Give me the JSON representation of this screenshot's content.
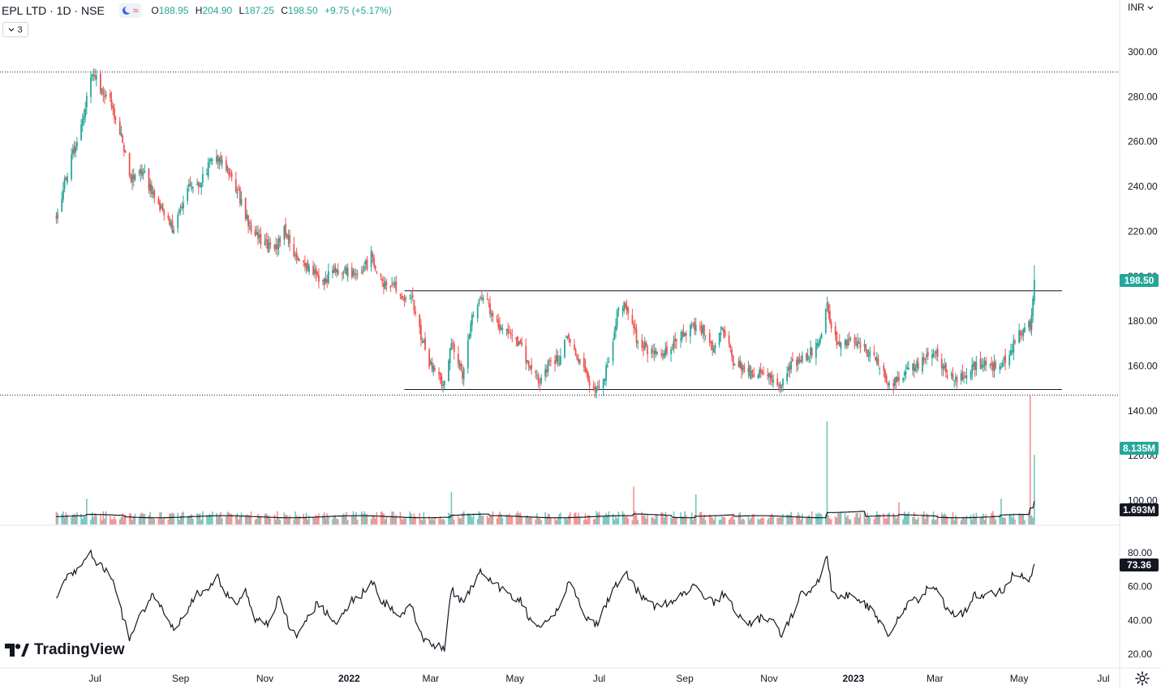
{
  "header": {
    "symbol": "EPL LTD · 1D · NSE",
    "open_key": "O",
    "open": "188.95",
    "high_key": "H",
    "high": "204.90",
    "low_key": "L",
    "low": "187.25",
    "close_key": "C",
    "close": "198.50",
    "change": "+9.75 (+5.17%)",
    "collapse_count": "3",
    "currency": "INR"
  },
  "branding": {
    "logo_text": "TradingView"
  },
  "icons": {
    "moon": "moon-icon",
    "wave": "wave-icon",
    "chevron": "chevron-down-icon",
    "settings": "gear-icon"
  },
  "colors": {
    "up": "#26a69a",
    "down": "#ef5350",
    "line": "#131722",
    "tag": "#26a69a",
    "tag_dark": "#131722"
  },
  "price_tag": "198.50",
  "volume_tag": "8.135M",
  "volume_ma_tag": "1.693M",
  "rsi_tag": "73.36",
  "chart_data": {
    "type": "candlestick",
    "x_labels": [
      "Jul",
      "Sep",
      "Nov",
      "2022",
      "Mar",
      "May",
      "Jul",
      "Sep",
      "Nov",
      "2023",
      "Mar",
      "May",
      "Jul"
    ],
    "price_axis": {
      "ticks": [
        "300.00",
        "280.00",
        "260.00",
        "240.00",
        "220.00",
        "200.00",
        "180.00",
        "160.00",
        "140.00",
        "120.00",
        "100.00"
      ],
      "range": [
        95,
        308
      ]
    },
    "rsi_axis": {
      "ticks": [
        "80.00",
        "60.00",
        "40.00",
        "20.00"
      ],
      "range": [
        15,
        85
      ]
    },
    "horizontal_lines": [
      {
        "value": 291,
        "style": "dotted"
      },
      {
        "value": 147,
        "style": "dotted"
      }
    ],
    "trend_lines": [
      {
        "from": "2022-02-10",
        "to": "2023-06-01",
        "value": 193.5
      },
      {
        "from": "2022-02-10",
        "to": "2023-06-01",
        "value": 149.5
      }
    ],
    "price_path": [
      [
        "2021-06-03",
        228
      ],
      [
        "2021-06-14",
        252
      ],
      [
        "2021-06-21",
        268
      ],
      [
        "2021-06-30",
        292
      ],
      [
        "2021-07-05",
        283
      ],
      [
        "2021-07-12",
        278
      ],
      [
        "2021-07-20",
        262
      ],
      [
        "2021-07-27",
        244
      ],
      [
        "2021-08-05",
        246
      ],
      [
        "2021-08-16",
        232
      ],
      [
        "2021-08-26",
        221
      ],
      [
        "2021-09-06",
        239
      ],
      [
        "2021-09-16",
        242
      ],
      [
        "2021-09-24",
        253
      ],
      [
        "2021-10-01",
        252
      ],
      [
        "2021-10-11",
        240
      ],
      [
        "2021-10-18",
        226
      ],
      [
        "2021-10-25",
        219
      ],
      [
        "2021-11-08",
        210
      ],
      [
        "2021-11-15",
        222
      ],
      [
        "2021-11-22",
        209
      ],
      [
        "2021-12-01",
        204
      ],
      [
        "2021-12-13",
        197
      ],
      [
        "2021-12-20",
        203
      ],
      [
        "2022-01-03",
        201
      ],
      [
        "2022-01-10",
        201
      ],
      [
        "2022-01-17",
        209
      ],
      [
        "2022-01-24",
        198
      ],
      [
        "2022-02-02",
        196
      ],
      [
        "2022-02-08",
        188
      ],
      [
        "2022-02-15",
        191
      ],
      [
        "2022-02-22",
        174
      ],
      [
        "2022-03-01",
        160
      ],
      [
        "2022-03-08",
        154
      ],
      [
        "2022-03-11",
        151
      ],
      [
        "2022-03-16",
        170
      ],
      [
        "2022-03-21",
        163
      ],
      [
        "2022-03-24",
        156
      ],
      [
        "2022-03-30",
        180
      ],
      [
        "2022-04-06",
        193
      ],
      [
        "2022-04-12",
        186
      ],
      [
        "2022-04-20",
        178
      ],
      [
        "2022-04-28",
        173
      ],
      [
        "2022-05-05",
        169
      ],
      [
        "2022-05-12",
        158
      ],
      [
        "2022-05-19",
        153
      ],
      [
        "2022-05-26",
        162
      ],
      [
        "2022-06-02",
        163
      ],
      [
        "2022-06-09",
        174
      ],
      [
        "2022-06-16",
        162
      ],
      [
        "2022-06-24",
        153
      ],
      [
        "2022-06-30",
        150
      ],
      [
        "2022-07-05",
        155
      ],
      [
        "2022-07-11",
        172
      ],
      [
        "2022-07-15",
        186
      ],
      [
        "2022-07-21",
        186
      ],
      [
        "2022-07-28",
        172
      ],
      [
        "2022-08-04",
        168
      ],
      [
        "2022-08-11",
        165
      ],
      [
        "2022-08-18",
        167
      ],
      [
        "2022-08-25",
        170
      ],
      [
        "2022-09-01",
        174
      ],
      [
        "2022-09-08",
        178
      ],
      [
        "2022-09-15",
        175
      ],
      [
        "2022-09-22",
        168
      ],
      [
        "2022-09-29",
        176
      ],
      [
        "2022-10-06",
        163
      ],
      [
        "2022-10-13",
        159
      ],
      [
        "2022-10-20",
        156
      ],
      [
        "2022-10-27",
        158
      ],
      [
        "2022-11-03",
        154
      ],
      [
        "2022-11-10",
        151
      ],
      [
        "2022-11-17",
        160
      ],
      [
        "2022-11-24",
        162
      ],
      [
        "2022-12-01",
        166
      ],
      [
        "2022-12-08",
        170
      ],
      [
        "2022-12-13",
        190
      ],
      [
        "2022-12-16",
        175
      ],
      [
        "2022-12-22",
        168
      ],
      [
        "2022-12-29",
        171
      ],
      [
        "2023-01-05",
        170
      ],
      [
        "2023-01-12",
        166
      ],
      [
        "2023-01-19",
        162
      ],
      [
        "2023-01-26",
        151
      ],
      [
        "2023-02-02",
        153
      ],
      [
        "2023-02-09",
        158
      ],
      [
        "2023-02-16",
        160
      ],
      [
        "2023-02-23",
        165
      ],
      [
        "2023-03-02",
        166
      ],
      [
        "2023-03-09",
        158
      ],
      [
        "2023-03-16",
        154
      ],
      [
        "2023-03-23",
        155
      ],
      [
        "2023-03-30",
        160
      ],
      [
        "2023-04-06",
        160
      ],
      [
        "2023-04-13",
        160
      ],
      [
        "2023-04-20",
        162
      ],
      [
        "2023-04-27",
        170
      ],
      [
        "2023-05-04",
        178
      ],
      [
        "2023-05-09",
        178
      ],
      [
        "2023-05-11",
        190
      ],
      [
        "2023-05-12",
        198.5
      ]
    ],
    "rsi_path": [
      [
        "2021-06-03",
        55
      ],
      [
        "2021-06-10",
        65
      ],
      [
        "2021-06-17",
        70
      ],
      [
        "2021-06-28",
        79
      ],
      [
        "2021-07-05",
        72
      ],
      [
        "2021-07-12",
        68
      ],
      [
        "2021-07-19",
        48
      ],
      [
        "2021-07-26",
        30
      ],
      [
        "2021-08-02",
        42
      ],
      [
        "2021-08-12",
        55
      ],
      [
        "2021-08-19",
        48
      ],
      [
        "2021-08-26",
        35
      ],
      [
        "2021-09-02",
        40
      ],
      [
        "2021-09-13",
        56
      ],
      [
        "2021-09-20",
        58
      ],
      [
        "2021-09-27",
        67
      ],
      [
        "2021-10-04",
        55
      ],
      [
        "2021-10-11",
        50
      ],
      [
        "2021-10-18",
        58
      ],
      [
        "2021-10-25",
        40
      ],
      [
        "2021-11-04",
        38
      ],
      [
        "2021-11-11",
        55
      ],
      [
        "2021-11-18",
        38
      ],
      [
        "2021-11-25",
        30
      ],
      [
        "2021-12-02",
        42
      ],
      [
        "2021-12-09",
        50
      ],
      [
        "2021-12-16",
        44
      ],
      [
        "2021-12-23",
        40
      ],
      [
        "2022-01-03",
        52
      ],
      [
        "2022-01-10",
        55
      ],
      [
        "2022-01-17",
        65
      ],
      [
        "2022-01-24",
        52
      ],
      [
        "2022-01-31",
        48
      ],
      [
        "2022-02-07",
        40
      ],
      [
        "2022-02-14",
        52
      ],
      [
        "2022-02-21",
        32
      ],
      [
        "2022-03-01",
        26
      ],
      [
        "2022-03-08",
        24
      ],
      [
        "2022-03-11",
        22
      ],
      [
        "2022-03-16",
        58
      ],
      [
        "2022-03-24",
        50
      ],
      [
        "2022-03-31",
        60
      ],
      [
        "2022-04-07",
        70
      ],
      [
        "2022-04-14",
        64
      ],
      [
        "2022-04-21",
        58
      ],
      [
        "2022-04-28",
        55
      ],
      [
        "2022-05-05",
        52
      ],
      [
        "2022-05-12",
        40
      ],
      [
        "2022-05-19",
        36
      ],
      [
        "2022-05-26",
        40
      ],
      [
        "2022-06-02",
        48
      ],
      [
        "2022-06-09",
        63
      ],
      [
        "2022-06-16",
        52
      ],
      [
        "2022-06-23",
        40
      ],
      [
        "2022-06-30",
        38
      ],
      [
        "2022-07-07",
        52
      ],
      [
        "2022-07-14",
        62
      ],
      [
        "2022-07-21",
        68
      ],
      [
        "2022-07-28",
        58
      ],
      [
        "2022-08-04",
        52
      ],
      [
        "2022-08-11",
        48
      ],
      [
        "2022-08-18",
        50
      ],
      [
        "2022-08-25",
        52
      ],
      [
        "2022-09-01",
        56
      ],
      [
        "2022-09-08",
        60
      ],
      [
        "2022-09-15",
        55
      ],
      [
        "2022-09-22",
        50
      ],
      [
        "2022-09-29",
        56
      ],
      [
        "2022-10-06",
        48
      ],
      [
        "2022-10-13",
        40
      ],
      [
        "2022-10-20",
        38
      ],
      [
        "2022-10-27",
        42
      ],
      [
        "2022-11-03",
        40
      ],
      [
        "2022-11-10",
        32
      ],
      [
        "2022-11-17",
        42
      ],
      [
        "2022-11-24",
        55
      ],
      [
        "2022-12-01",
        58
      ],
      [
        "2022-12-08",
        64
      ],
      [
        "2022-12-13",
        78
      ],
      [
        "2022-12-16",
        60
      ],
      [
        "2022-12-22",
        54
      ],
      [
        "2022-12-29",
        55
      ],
      [
        "2023-01-05",
        52
      ],
      [
        "2023-01-12",
        48
      ],
      [
        "2023-01-19",
        40
      ],
      [
        "2023-01-26",
        32
      ],
      [
        "2023-02-02",
        40
      ],
      [
        "2023-02-09",
        50
      ],
      [
        "2023-02-16",
        52
      ],
      [
        "2023-02-23",
        58
      ],
      [
        "2023-03-02",
        60
      ],
      [
        "2023-03-09",
        48
      ],
      [
        "2023-03-16",
        42
      ],
      [
        "2023-03-23",
        45
      ],
      [
        "2023-03-30",
        55
      ],
      [
        "2023-04-06",
        55
      ],
      [
        "2023-04-13",
        56
      ],
      [
        "2023-04-20",
        58
      ],
      [
        "2023-04-27",
        68
      ],
      [
        "2023-05-04",
        66
      ],
      [
        "2023-05-09",
        64
      ],
      [
        "2023-05-11",
        70
      ],
      [
        "2023-05-12",
        73.4
      ]
    ],
    "volume": {
      "baseline": 1.2,
      "ma_end": 1.693,
      "last": 8.135
    },
    "volume_spikes": [
      [
        "2021-06-25",
        3.0
      ],
      [
        "2022-03-16",
        3.8
      ],
      [
        "2022-07-26",
        4.4
      ],
      [
        "2022-09-09",
        3.5
      ],
      [
        "2022-12-13",
        12.0
      ],
      [
        "2023-02-03",
        2.6
      ],
      [
        "2023-04-18",
        3.0
      ],
      [
        "2023-05-09",
        15.0
      ],
      [
        "2023-05-12",
        8.1
      ]
    ]
  }
}
